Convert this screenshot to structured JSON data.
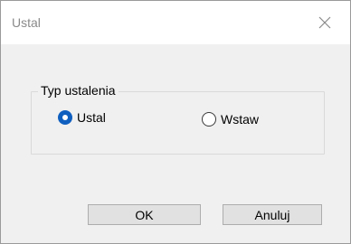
{
  "window": {
    "title": "Ustal",
    "close_icon": "close-icon"
  },
  "group": {
    "legend": "Typ ustalenia",
    "options": [
      {
        "label": "Ustal",
        "checked": true
      },
      {
        "label": "Wstaw",
        "checked": false
      }
    ]
  },
  "buttons": {
    "ok_label": "OK",
    "cancel_label": "Anuluj"
  },
  "colors": {
    "dialog_bg": "#f0f0f0",
    "titlebar_bg": "#ffffff",
    "radio_accent": "#0f5fbf",
    "button_bg": "#e1e1e1"
  }
}
